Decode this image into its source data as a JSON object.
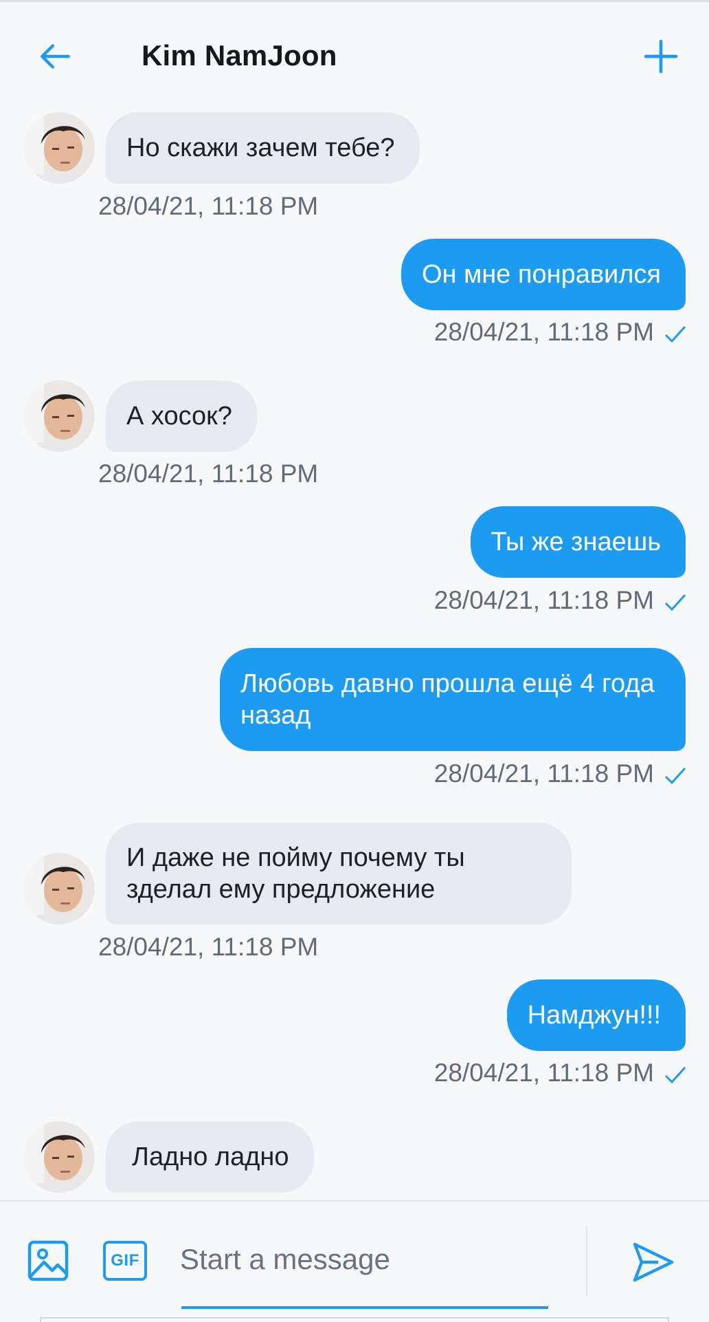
{
  "header": {
    "title": "Kim NamJoon",
    "back_icon": "arrow-left-icon",
    "new_icon": "plus-icon"
  },
  "messages": [
    {
      "from": "them",
      "text": "Но скажи зачем тебе?",
      "time": "28/04/21, 11:18 PM"
    },
    {
      "from": "me",
      "text": "Он мне понравился",
      "time": "28/04/21, 11:18 PM",
      "read": true
    },
    {
      "from": "them",
      "text": "А хосок?",
      "time": "28/04/21, 11:18 PM"
    },
    {
      "from": "me",
      "text": "Ты же знаешь",
      "time": "28/04/21, 11:18 PM",
      "read": true
    },
    {
      "from": "me",
      "text": "Любовь давно прошла ещё 4 года назад",
      "time": "28/04/21, 11:18 PM",
      "read": true
    },
    {
      "from": "them",
      "text": "И даже не пойму почему ты зделал ему предложение",
      "time": "28/04/21, 11:18 PM"
    },
    {
      "from": "me",
      "text": "Намджун!!!",
      "time": "28/04/21, 11:18 PM",
      "read": true
    },
    {
      "from": "them",
      "text": "Ладно ладно"
    }
  ],
  "composer": {
    "placeholder": "Start a message",
    "gif_label": "GIF",
    "media_icon": "image-icon",
    "send_icon": "send-icon"
  },
  "colors": {
    "accent": "#1d9bf0",
    "incoming_bubble": "#e7eaf1",
    "background": "#f7f8fa",
    "timestamp": "#5f6b76"
  }
}
